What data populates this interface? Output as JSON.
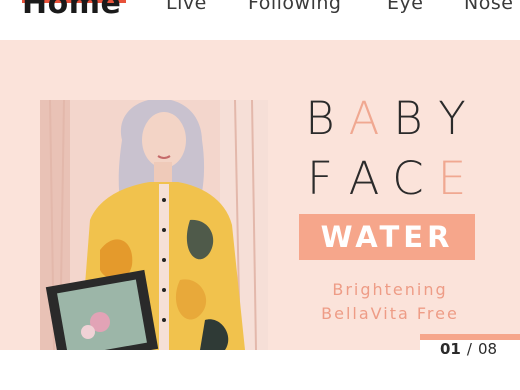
{
  "nav": {
    "items": [
      {
        "label": "Home",
        "active": true
      },
      {
        "label": "Live"
      },
      {
        "label": "Following"
      },
      {
        "label": "Eye"
      },
      {
        "label": "Nose"
      }
    ],
    "accent_color": "#e8523a"
  },
  "banner": {
    "background_color": "#fbe3da",
    "accent_color": "#f6a68b",
    "title_line1": [
      "B",
      "A",
      "B",
      "Y"
    ],
    "title_line2": [
      "F",
      "A",
      "C",
      "E"
    ],
    "badge": "WATER",
    "subtitle1": "Brightening",
    "subtitle2": "BellaVita Free"
  },
  "pagination": {
    "current": "01",
    "separator": "/",
    "total": "08"
  }
}
